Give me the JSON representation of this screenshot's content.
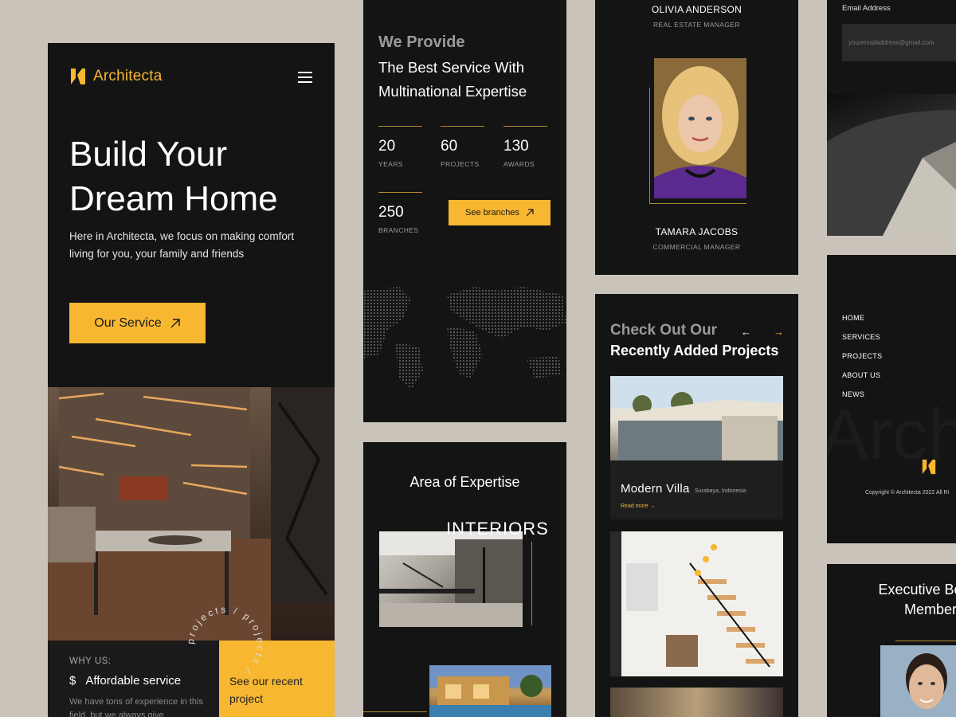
{
  "brand": {
    "name": "Architecta",
    "accent": "#f7b731",
    "dark": "#141414"
  },
  "hero": {
    "title": "Build Your Dream Home",
    "description": "Here in Architecta, we focus on making comfort living for you, your family and friends",
    "cta_label": "Our Service",
    "rotating_text": "projects / projects /"
  },
  "why": {
    "label": "WHY US:",
    "item_label": "Affordable service",
    "item_icon": "dollar-icon",
    "description": "We have tons of experience in this field, but we always give",
    "recent_label": "See our recent project"
  },
  "provide": {
    "kicker": "We Provide",
    "title": "The Best Service With Multinational Expertise",
    "stats": [
      {
        "value": "20",
        "label": "YEARS"
      },
      {
        "value": "60",
        "label": "PROJECTS"
      },
      {
        "value": "130",
        "label": "AWARDS"
      },
      {
        "value": "250",
        "label": "BRANCHES"
      }
    ],
    "branches_button": "See branches"
  },
  "expertise": {
    "title": "Area of Expertise",
    "category": "INTERIORS"
  },
  "team": {
    "members": [
      {
        "name": "OLIVIA ANDERSON",
        "role": "REAL ESTATE MANAGER"
      },
      {
        "name": "TAMARA JACOBS",
        "role": "COMMERCIAL MANAGER"
      }
    ]
  },
  "projects": {
    "kicker": "Check Out Our",
    "title": "Recently Added Projects",
    "prev_icon": "arrow-left-icon",
    "next_icon": "arrow-right-icon",
    "featured": {
      "name": "Modern Villa",
      "location": "Surabaya, Indonesia",
      "read_more": "Read more"
    }
  },
  "newsletter": {
    "label": "Email Address",
    "placeholder": "youremailaddress@gmail.com"
  },
  "footer": {
    "nav": [
      "HOME",
      "SERVICES",
      "PROJECTS",
      "ABOUT US",
      "NEWS"
    ],
    "watermark": "Archi",
    "copyright": "Copyright © Architecta 2022   All Ri"
  },
  "board": {
    "title": "Executive Board Member"
  }
}
